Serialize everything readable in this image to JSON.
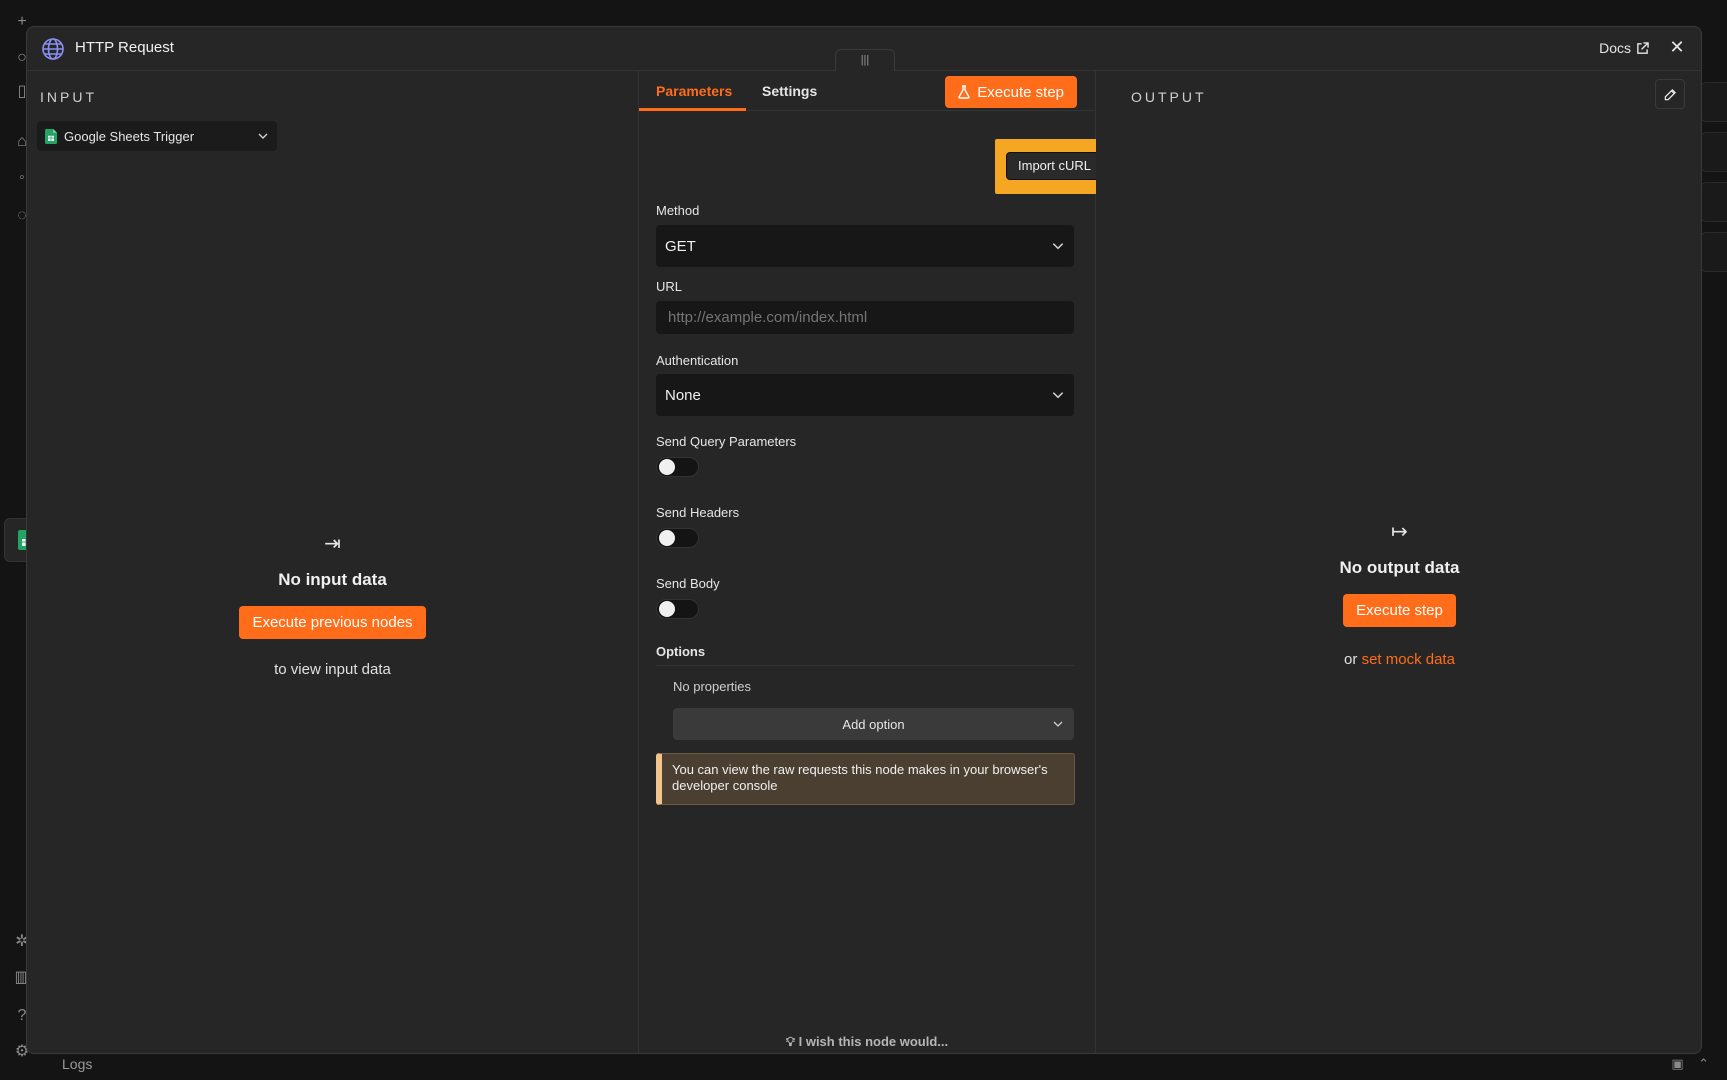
{
  "modal": {
    "title": "HTTP Request",
    "docs_label": "Docs",
    "drag_handle": "|||"
  },
  "input": {
    "heading": "INPUT",
    "node_select": "Google Sheets Trigger",
    "empty_title": "No input data",
    "execute_btn": "Execute previous nodes",
    "empty_sub": "to view input data"
  },
  "params": {
    "tabs": [
      {
        "label": "Parameters",
        "active": true
      },
      {
        "label": "Settings",
        "active": false
      }
    ],
    "execute_step": "Execute step",
    "import_curl": "Import cURL",
    "method_label": "Method",
    "method_value": "GET",
    "url_label": "URL",
    "url_placeholder": "http://example.com/index.html",
    "auth_label": "Authentication",
    "auth_value": "None",
    "toggles": [
      {
        "label": "Send Query Parameters",
        "on": false
      },
      {
        "label": "Send Headers",
        "on": false
      },
      {
        "label": "Send Body",
        "on": false
      }
    ],
    "options_label": "Options",
    "no_properties": "No properties",
    "add_option": "Add option",
    "notice": "You can view the raw requests this node makes in your browser's developer console",
    "wish": "I wish this node would..."
  },
  "output": {
    "heading": "OUTPUT",
    "empty_title": "No output data",
    "execute_btn": "Execute step",
    "mock_prefix": "or",
    "mock_link": "set mock data"
  },
  "footer": {
    "logs_label": "Logs"
  },
  "colors": {
    "accent": "#ff6d1a",
    "highlight": "#f5a623",
    "notice_bar": "#f2c48d",
    "sheets_green": "#21a464"
  }
}
